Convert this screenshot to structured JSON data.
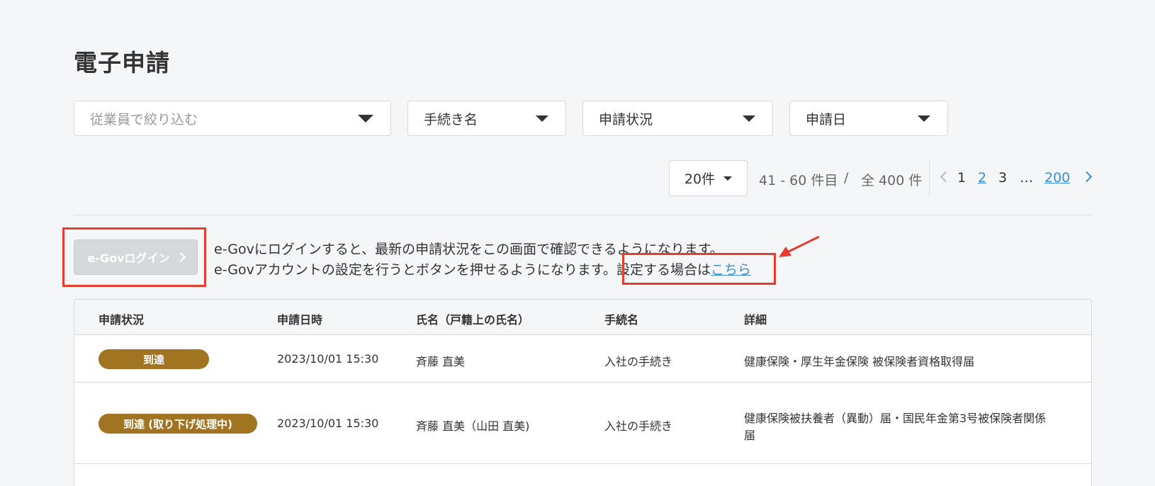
{
  "page": {
    "title": "電子申請"
  },
  "filters": {
    "employee_placeholder": "従業員で絞り込む",
    "procedure": "手続き名",
    "status": "申請状況",
    "date": "申請日"
  },
  "pagination": {
    "page_size": "20件",
    "range": "41 - 60 件目",
    "separator": "/",
    "total": "全 400 件",
    "pages": [
      "1",
      "2",
      "3",
      "…",
      "200"
    ],
    "current_link_pages": [
      "2",
      "200"
    ]
  },
  "egov": {
    "login_label": "e-Govログイン",
    "info_line1": "e-Govにログインすると、最新の申請状況をこの画面で確認できるようになります。",
    "info_line2_prefix": "e-Govアカウントの設定を行うとボタンを押せるようになります。",
    "info_line2_suffix": "設定する場合は",
    "info_link": "こちら"
  },
  "annotation_color": "#e53e2e",
  "table": {
    "headers": [
      "申請状況",
      "申請日時",
      "氏名（戸籍上の氏名）",
      "手続名",
      "詳細"
    ],
    "rows": [
      {
        "status": "到達",
        "datetime": "2023/10/01 15:30",
        "name": "斉藤 直美",
        "procedure": "入社の手続き",
        "detail": "健康保険・厚生年金保険 被保険者資格取得届"
      },
      {
        "status": "到達 (取り下げ処理中)",
        "datetime": "2023/10/01 15:30",
        "name": "斉藤 直美（山田 直美)",
        "procedure": "入社の手続き",
        "detail_line1": "健康保険被扶養者（異動）届・国民年金第3号被保険者関係",
        "detail_line2": "届"
      }
    ],
    "badge_color": "#a07421"
  }
}
